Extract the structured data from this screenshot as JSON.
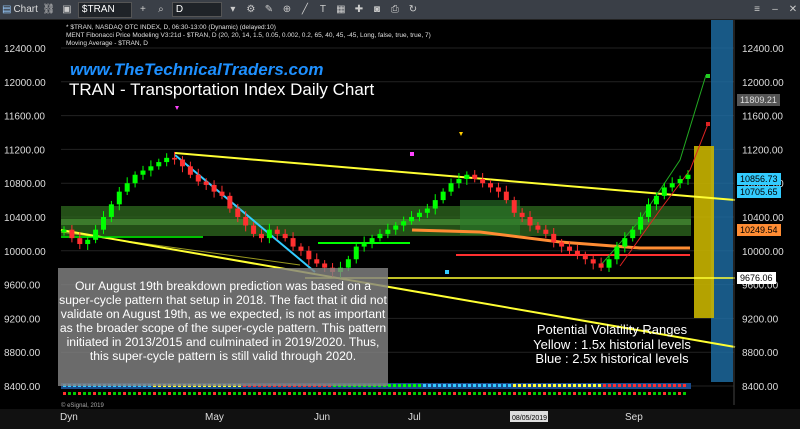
{
  "toolbar": {
    "chart_label": "Chart",
    "symbol": "$TRAN",
    "interval": "D"
  },
  "info": {
    "line1": "* $TRAN, NASDAQ OTC INDEX, D, 06:30-13:00 (Dynamic) (delayed:10)",
    "line2": "MENT Fibonacci Price Modeling V3:21d - $TRAN, D (20, 20, 14, 1.5, 0.05, 0.002, 0.2, 65, 40, 45, -45, Long, false, true, true, 7)",
    "line3": "Moving Average - $TRAN, D"
  },
  "header": {
    "site": "www.TheTechnicalTraders.com",
    "title": "TRAN - Transportation Index Daily Chart"
  },
  "note": {
    "text": "Our August 19th breakdown prediction was based on a super-cycle pattern that setup in 2018.  The fact that it did not validate on August 19th, as we expected, is not as important as the broader scope of the super-cycle pattern.  This pattern initiated in 2013/2015 and culminated in 2019/2020.  Thus, this super-cycle pattern is still valid through 2020."
  },
  "volatility": {
    "title": "Potential Volatility Ranges",
    "yellow": "Yellow : 1.5x historial levels",
    "blue": "Blue : 2.5x historical levels"
  },
  "copyright": "© eSignal, 2019",
  "colors": {
    "up": "#00ff00",
    "down": "#ff3030",
    "trend_line": "#ffff33",
    "cyan_line": "#33ccff",
    "ma_line": "#ff8c33",
    "green_zone": "#3a7a2a",
    "yellow_range": "#c8b400",
    "blue_range": "#1e6fa8"
  },
  "chart_data": {
    "type": "candlestick",
    "y_axis_ticks": [
      "12400.00",
      "12000.00",
      "11600.00",
      "11200.00",
      "10800.00",
      "10400.00",
      "10000.00",
      "9600.00",
      "9200.00",
      "8800.00",
      "8400.00"
    ],
    "ylim": [
      8300,
      12700
    ],
    "x_axis_ticks": [
      "Dyn",
      "May",
      "Jun",
      "Jul",
      "08/05/2019",
      "Sep"
    ],
    "price_tags": [
      {
        "value": "11809.21",
        "color": "#555555"
      },
      {
        "value": "10856.73",
        "color": "#33ccff"
      },
      {
        "value": "10705.65",
        "color": "#33ccff"
      },
      {
        "value": "10249.54",
        "color": "#ff8c33"
      },
      {
        "value": "9676.06",
        "color": "#ffffff"
      }
    ],
    "closes": [
      10250,
      10150,
      10080,
      10130,
      10250,
      10400,
      10550,
      10700,
      10800,
      10900,
      10950,
      11000,
      11050,
      11100,
      11080,
      11000,
      10900,
      10820,
      10780,
      10700,
      10650,
      10500,
      10400,
      10300,
      10200,
      10150,
      10250,
      10200,
      10150,
      10050,
      10000,
      9900,
      9850,
      9800,
      9750,
      9800,
      9900,
      10050,
      10100,
      10150,
      10200,
      10250,
      10300,
      10350,
      10400,
      10450,
      10500,
      10600,
      10700,
      10800,
      10850,
      10900,
      10850,
      10800,
      10750,
      10700,
      10600,
      10450,
      10400,
      10300,
      10250,
      10200,
      10100,
      10050,
      10000,
      9950,
      9900,
      9850,
      9800,
      9900,
      10050,
      10150,
      10250,
      10400,
      10550,
      10650,
      10750,
      10800,
      10850,
      10900
    ]
  }
}
